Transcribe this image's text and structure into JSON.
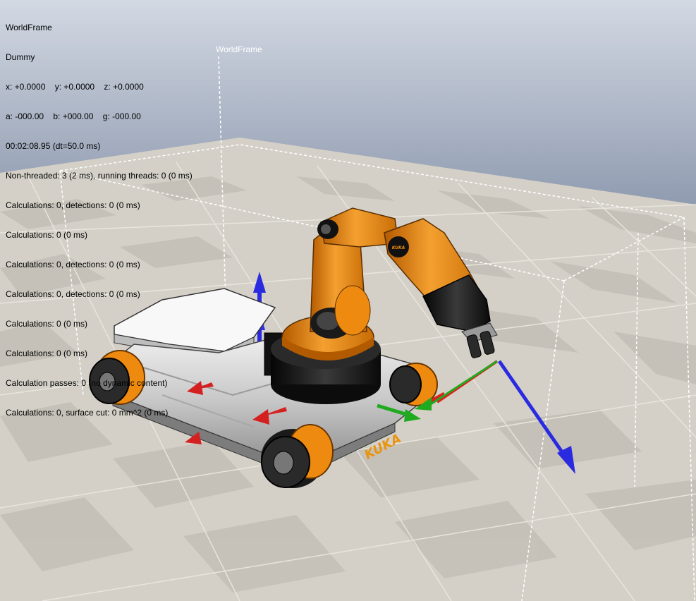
{
  "hud": {
    "lines": [
      "WorldFrame",
      "Dummy",
      "x: +0.0000    y: +0.0000    z: +0.0000",
      "a: -000.00    b: +000.00    g: -000.00",
      "00:02:08.95 (dt=50.0 ms)",
      "Non-threaded: 3 (2 ms), running threads: 0 (0 ms)",
      "Calculations: 0, detections: 0 (0 ms)",
      "Calculations: 0 (0 ms)",
      "Calculations: 0, detections: 0 (0 ms)",
      "Calculations: 0, detections: 0 (0 ms)",
      "Calculations: 0 (0 ms)",
      "Calculations: 0 (0 ms)",
      "Calculation passes: 0 (no dynamic content)",
      "Calculations: 0, surface cut: 0 mm^2 (0 ms)"
    ]
  },
  "scene": {
    "frame_label": "WorldFrame",
    "robot_logo": "KUKA",
    "colors": {
      "sky_top": "#d5dbe5",
      "sky_bottom": "#8e9bb0",
      "floor_light": "#d7d3ca",
      "floor_dark": "#c2beb5",
      "robot_orange": "#ee8a10",
      "axis_x": "#e0201c",
      "axis_y": "#1faa1f",
      "axis_z": "#2a2ae0"
    }
  }
}
